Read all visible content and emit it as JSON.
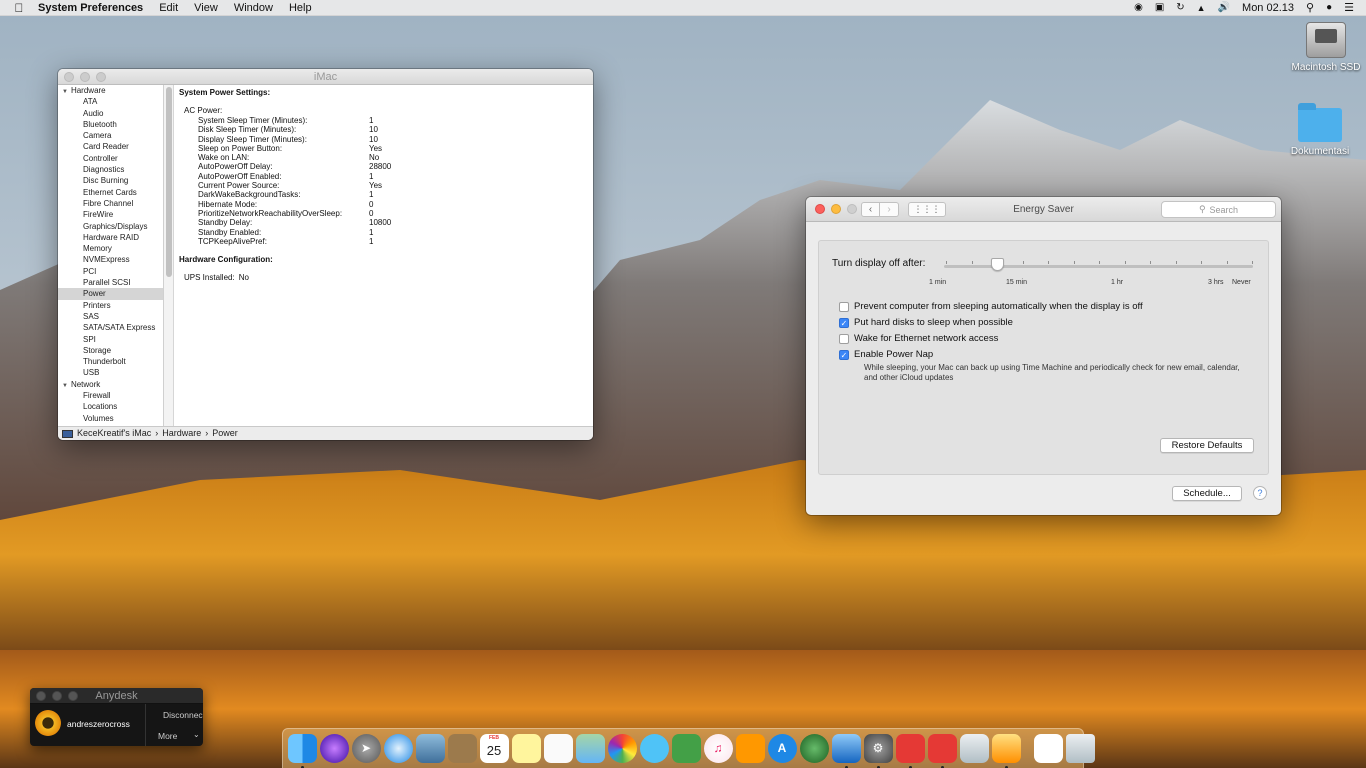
{
  "menubar": {
    "app_name": "System Preferences",
    "items": [
      "Edit",
      "View",
      "Window",
      "Help"
    ],
    "clock": "Mon 02.13"
  },
  "desktop": {
    "icons": [
      {
        "label": "Macintosh SSD"
      },
      {
        "label": "Dokumentasi"
      }
    ]
  },
  "sysinfo": {
    "title": "iMac",
    "sidebar": {
      "hardware_group": "Hardware",
      "hardware_items": [
        "ATA",
        "Audio",
        "Bluetooth",
        "Camera",
        "Card Reader",
        "Controller",
        "Diagnostics",
        "Disc Burning",
        "Ethernet Cards",
        "Fibre Channel",
        "FireWire",
        "Graphics/Displays",
        "Hardware RAID",
        "Memory",
        "NVMExpress",
        "PCI",
        "Parallel SCSI",
        "Power",
        "Printers",
        "SAS",
        "SATA/SATA Express",
        "SPI",
        "Storage",
        "Thunderbolt",
        "USB"
      ],
      "selected": "Power",
      "network_group": "Network",
      "network_items": [
        "Firewall",
        "Locations",
        "Volumes"
      ]
    },
    "main": {
      "heading": "System Power Settings:",
      "ac_power_label": "AC Power:",
      "settings": [
        {
          "k": "System Sleep Timer (Minutes):",
          "v": "1"
        },
        {
          "k": "Disk Sleep Timer (Minutes):",
          "v": "10"
        },
        {
          "k": "Display Sleep Timer (Minutes):",
          "v": "10"
        },
        {
          "k": "Sleep on Power Button:",
          "v": "Yes"
        },
        {
          "k": "Wake on LAN:",
          "v": "No"
        },
        {
          "k": "AutoPowerOff Delay:",
          "v": "28800"
        },
        {
          "k": "AutoPowerOff Enabled:",
          "v": "1"
        },
        {
          "k": "Current Power Source:",
          "v": "Yes"
        },
        {
          "k": "DarkWakeBackgroundTasks:",
          "v": "1"
        },
        {
          "k": "Hibernate Mode:",
          "v": "0"
        },
        {
          "k": "PrioritizeNetworkReachabilityOverSleep:",
          "v": "0"
        },
        {
          "k": "Standby Delay:",
          "v": "10800"
        },
        {
          "k": "Standby Enabled:",
          "v": "1"
        },
        {
          "k": "TCPKeepAlivePref:",
          "v": "1"
        }
      ],
      "hw_heading": "Hardware Configuration:",
      "ups_label": "UPS Installed:",
      "ups_value": "No"
    },
    "path": [
      "KeceKreatif's iMac",
      "Hardware",
      "Power"
    ]
  },
  "energy": {
    "title": "Energy Saver",
    "search_placeholder": "Search",
    "slider_label": "Turn display off after:",
    "slider_ticks": [
      "1 min",
      "15 min",
      "1 hr",
      "3 hrs",
      "Never"
    ],
    "slider_value": "15 min",
    "checkboxes": [
      {
        "label": "Prevent computer from sleeping automatically when the display is off",
        "checked": false
      },
      {
        "label": "Put hard disks to sleep when possible",
        "checked": true
      },
      {
        "label": "Wake for Ethernet network access",
        "checked": false
      },
      {
        "label": "Enable Power Nap",
        "checked": true
      }
    ],
    "power_nap_desc": "While sleeping, your Mac can back up using Time Machine and periodically check for new email, calendar, and other iCloud updates",
    "restore_label": "Restore Defaults",
    "schedule_label": "Schedule...",
    "help_label": "?"
  },
  "anydesk": {
    "title": "Anydesk",
    "user": "andreszerocross",
    "disconnect": "Disconnec",
    "more": "More"
  },
  "dock": {
    "calendar_day": "25",
    "calendar_month": "FEB"
  }
}
